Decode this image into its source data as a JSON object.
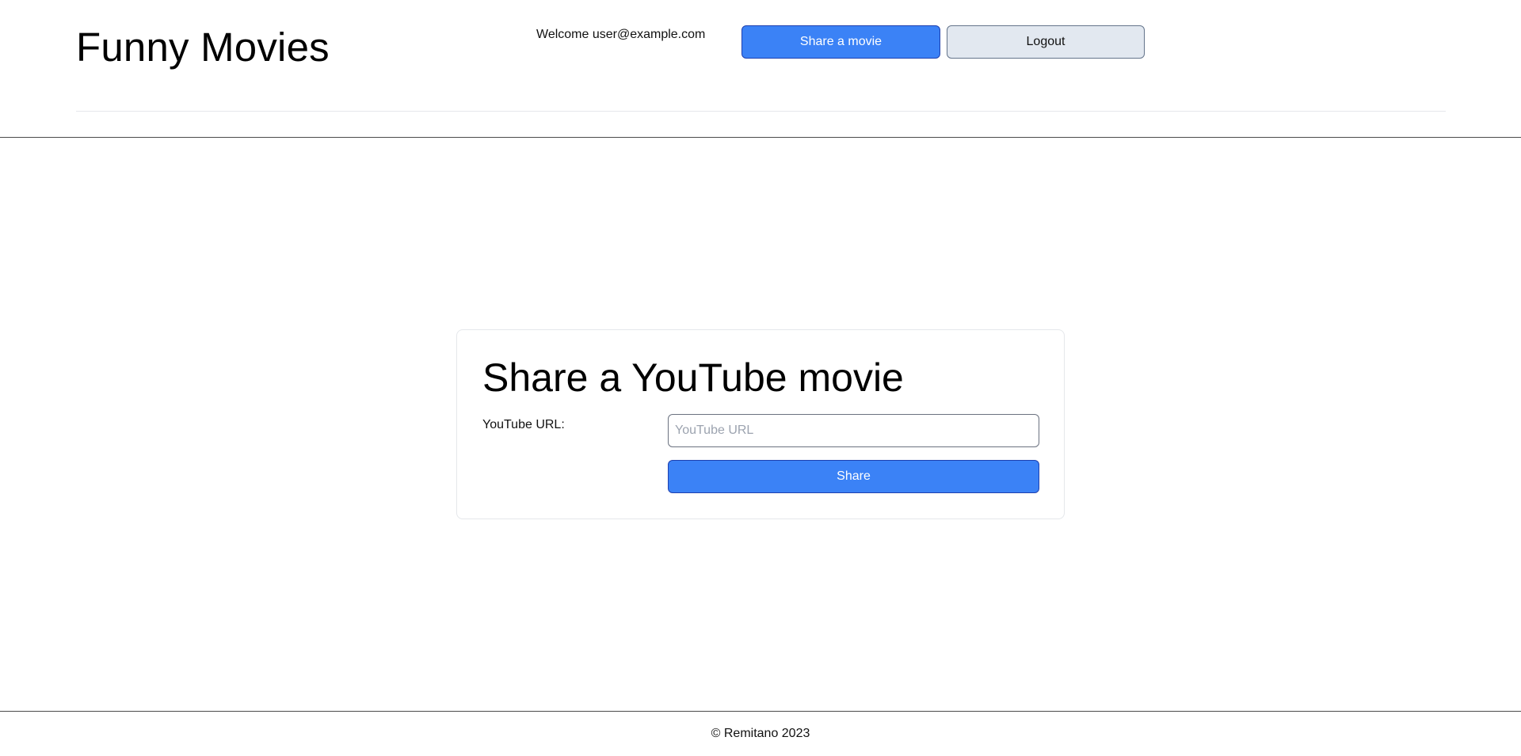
{
  "header": {
    "brand": "Funny Movies",
    "welcome_text": "Welcome user@example.com",
    "share_movie_label": "Share a movie",
    "logout_label": "Logout"
  },
  "share_form": {
    "title": "Share a YouTube movie",
    "url_label": "YouTube URL:",
    "url_placeholder": "YouTube URL",
    "url_value": "",
    "share_label": "Share"
  },
  "footer": {
    "copyright": "© Remitano 2023"
  },
  "colors": {
    "primary": "#3b82f6",
    "primary_border": "#1e40af",
    "secondary": "#e2e8f0",
    "secondary_border": "#64748b"
  }
}
